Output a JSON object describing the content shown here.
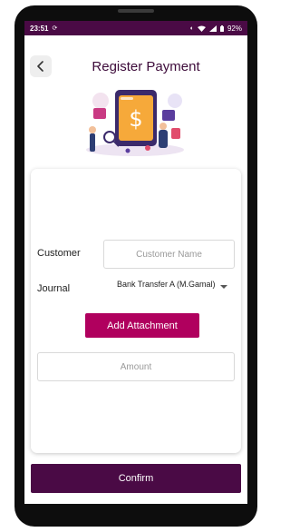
{
  "statusbar": {
    "time": "23:51",
    "battery": "92%",
    "icons": [
      "sync-icon",
      "vibrate-icon",
      "wifi-icon",
      "signal-icon",
      "battery-icon"
    ]
  },
  "header": {
    "title": "Register Payment",
    "back_icon": "chevron-left-icon"
  },
  "form": {
    "customer_label": "Customer",
    "customer_placeholder": "Customer Name",
    "journal_label": "Journal",
    "journal_value": "Bank Transfer A (M.Gamal)",
    "attach_label": "Add Attachment",
    "amount_placeholder": "Amount"
  },
  "footer": {
    "confirm_label": "Confirm"
  },
  "colors": {
    "primary": "#4a0a45",
    "accent": "#b0005e"
  }
}
